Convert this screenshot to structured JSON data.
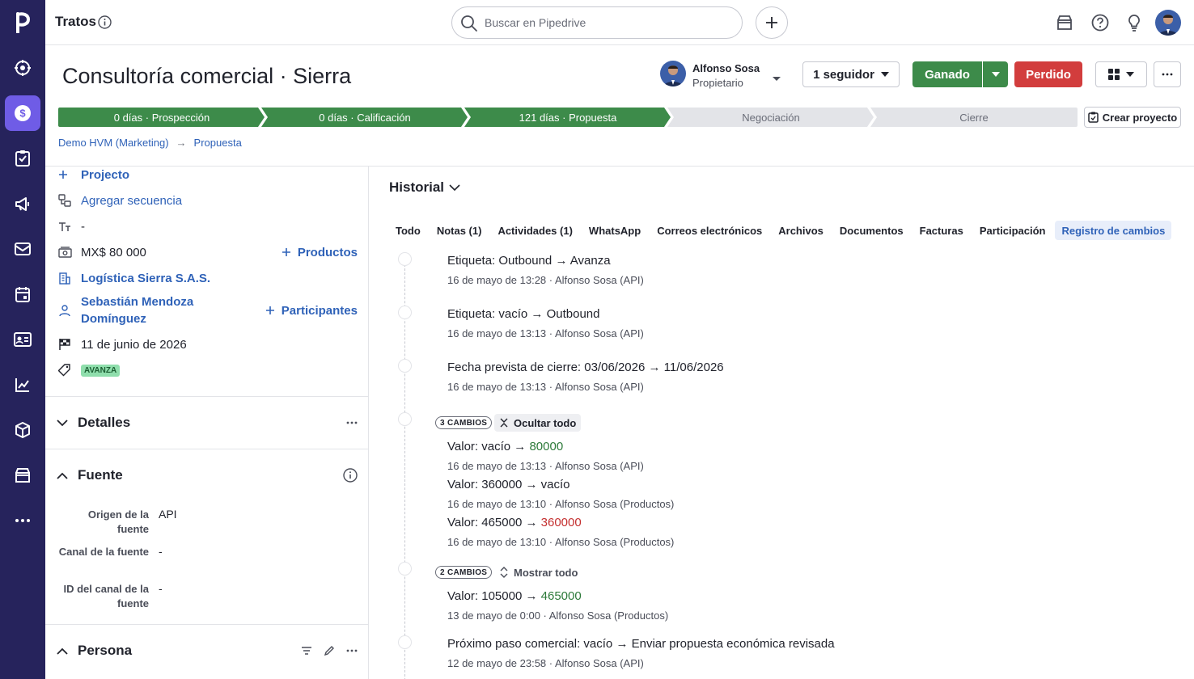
{
  "app": {
    "section_title": "Tratos",
    "search_placeholder": "Buscar en Pipedrive"
  },
  "nav": {
    "items": [
      {
        "name": "leads-icon"
      },
      {
        "name": "deals-icon"
      },
      {
        "name": "activities-icon"
      },
      {
        "name": "campaigns-icon"
      },
      {
        "name": "mail-icon"
      },
      {
        "name": "calendar-icon"
      },
      {
        "name": "contacts-icon"
      },
      {
        "name": "insights-icon"
      },
      {
        "name": "products-icon"
      },
      {
        "name": "marketplace-icon"
      },
      {
        "name": "more-icon"
      }
    ],
    "active": "deals-icon"
  },
  "deal": {
    "title": "Consultoría comercial · Sierra",
    "owner_name": "Alfonso Sosa",
    "owner_role": "Propietario",
    "followers_label": "1 seguidor",
    "won_label": "Ganado",
    "lost_label": "Perdido",
    "create_project_label": "Crear proyecto"
  },
  "pipeline": {
    "stages": [
      {
        "label": "0 días · Prospección",
        "done": true
      },
      {
        "label": "0 días · Calificación",
        "done": true
      },
      {
        "label": "121 días · Propuesta",
        "done": true
      },
      {
        "label": "Negociación",
        "done": false
      },
      {
        "label": "Cierre",
        "done": false
      }
    ]
  },
  "breadcrumb": {
    "pipeline": "Demo HVM (Marketing)",
    "stage": "Propuesta",
    "arrow": "→"
  },
  "summary": {
    "project_link": "Projecto",
    "sequence_link": "Agregar secuencia",
    "text_value": "-",
    "value": "MX$ 80 000",
    "products_link": "Productos",
    "organization": "Logística Sierra S.A.S.",
    "person": "Sebastián Mendoza Domínguez",
    "participants_link": "Participantes",
    "close_date": "11 de junio de 2026",
    "label_tag": "AVANZA"
  },
  "sections": {
    "details": "Detalles",
    "source": "Fuente",
    "person": "Persona"
  },
  "source_fields": [
    {
      "label": "Origen de la fuente",
      "value": "API"
    },
    {
      "label": "Canal de la fuente",
      "value": "-"
    },
    {
      "label": "ID del canal de la fuente",
      "value": "-"
    }
  ],
  "history": {
    "heading": "Historial",
    "tabs": [
      "Todo",
      "Notas (1)",
      "Actividades (1)",
      "WhatsApp",
      "Correos electrónicos",
      "Archivos",
      "Documentos",
      "Facturas",
      "Participación",
      "Registro de cambios"
    ],
    "active_tab": "Registro de cambios",
    "events": {
      "e1": {
        "field": "Etiqueta",
        "from": "Outbound",
        "to": "Avanza",
        "meta": "16 de mayo de 13:28 · Alfonso Sosa (API)"
      },
      "e2": {
        "field": "Etiqueta",
        "from": "vacío",
        "to": "Outbound",
        "meta": "16 de mayo de 13:13 · Alfonso Sosa (API)"
      },
      "e3": {
        "field": "Fecha prevista de cierre",
        "from": "03/06/2026",
        "to": "11/06/2026",
        "meta": "16 de mayo de 13:13 · Alfonso Sosa (API)"
      },
      "g1": {
        "badge": "3 CAMBIOS",
        "toggle": "Ocultar todo"
      },
      "g1a": {
        "field": "Valor",
        "from": "vacío",
        "to": "80000",
        "meta": "16 de mayo de 13:13 · Alfonso Sosa (API)"
      },
      "g1b": {
        "field": "Valor",
        "from": "360000",
        "to": "vacío",
        "meta": "16 de mayo de 13:10 · Alfonso Sosa (Productos)"
      },
      "g1c": {
        "field": "Valor",
        "from": "465000",
        "to": "360000",
        "meta": "16 de mayo de 13:10 · Alfonso Sosa (Productos)"
      },
      "g2": {
        "badge": "2 CAMBIOS",
        "toggle": "Mostrar todo"
      },
      "g2a": {
        "field": "Valor",
        "from": "105000",
        "to": "465000",
        "meta": "13 de mayo de 0:00 · Alfonso Sosa (Productos)"
      },
      "e4": {
        "field": "Próximo paso comercial",
        "from": "vacío",
        "to": "Enviar propuesta económica revisada",
        "meta": "12 de mayo de 23:58 · Alfonso Sosa (API)"
      }
    },
    "separator": ":",
    "arrow": "→"
  },
  "colors": {
    "nav_bg": "#26235c",
    "nav_active": "#6f5ce6",
    "won": "#3d8b4a",
    "lost": "#d23d3d",
    "link": "#2f62b8",
    "stage_done": "#3d8b4a",
    "stage_todo": "#e3e4e8"
  }
}
